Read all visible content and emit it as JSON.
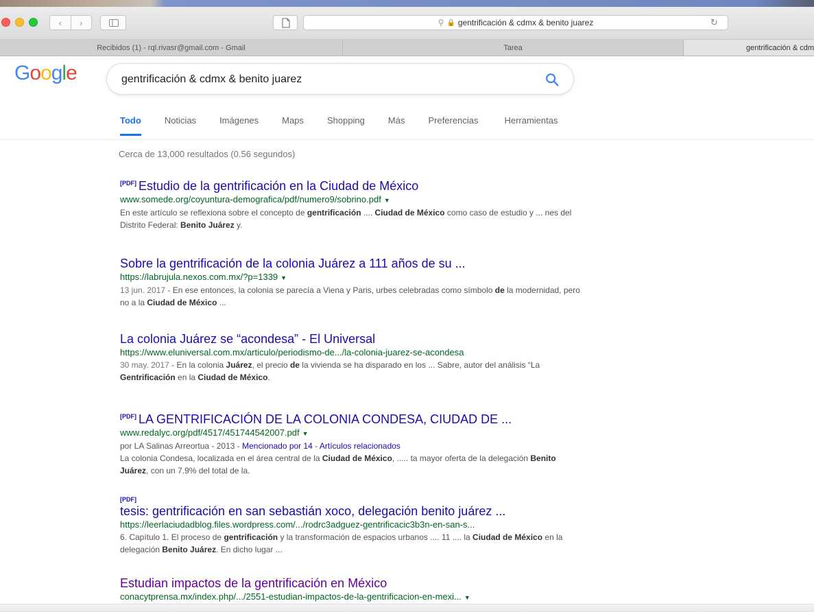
{
  "browser": {
    "address_text": "gentrificación & cdmx & benito juarez",
    "tabs": [
      {
        "label": "Recibidos (1) - rql.rivasr@gmail.com - Gmail"
      },
      {
        "label": "Tarea"
      },
      {
        "label": "gentrificación & cdm"
      }
    ],
    "back_glyph": "‹",
    "forward_glyph": "›"
  },
  "google": {
    "logo_letters": [
      "G",
      "o",
      "o",
      "g",
      "l",
      "e"
    ],
    "query": "gentrificación & cdmx & benito juarez",
    "tabs": [
      {
        "label": "Todo",
        "active": true
      },
      {
        "label": "Noticias"
      },
      {
        "label": "Imágenes"
      },
      {
        "label": "Maps"
      },
      {
        "label": "Shopping"
      },
      {
        "label": "Más"
      },
      {
        "label": "Preferencias"
      },
      {
        "label": "Herramientas"
      }
    ],
    "stats": "Cerca de 13,000 resultados (0.56 segundos)"
  },
  "results": [
    {
      "pdf_tag": "[PDF]",
      "title": "Estudio de la gentrificación en la Ciudad de México",
      "url": "www.somede.org/coyuntura-demografica/pdf/numero9/sobrino.pdf",
      "snippet": [
        {
          "t": "En este artículo se reflexiona sobre el concepto de "
        },
        {
          "t": "gentrificación",
          "b": true
        },
        {
          "t": " .... "
        },
        {
          "t": "Ciudad de México",
          "b": true
        },
        {
          "t": " como caso de estudio y ... nes del Distrito Federal: "
        },
        {
          "t": "Benito Juárez",
          "b": true
        },
        {
          "t": " y."
        }
      ]
    },
    {
      "title": "Sobre la gentrificación de la colonia Juárez a 111 años de su ...",
      "url": "https://labrujula.nexos.com.mx/?p=1339",
      "date": "13 jun. 2017",
      "snippet": [
        {
          "t": " - En ese entonces, la colonia se parecía a Viena y Paris, urbes celebradas como símbolo "
        },
        {
          "t": "de",
          "b": true
        },
        {
          "t": " la modernidad, pero no a la "
        },
        {
          "t": "Ciudad de México",
          "b": true
        },
        {
          "t": " ..."
        }
      ]
    },
    {
      "title": "La colonia Juárez se “acondesa” - El Universal",
      "url": "https://www.eluniversal.com.mx/articulo/periodismo-de.../la-colonia-juarez-se-acondesa",
      "date": "30 may. 2017",
      "snippet": [
        {
          "t": " - En la colonia "
        },
        {
          "t": "Juárez",
          "b": true
        },
        {
          "t": ", el precio "
        },
        {
          "t": "de",
          "b": true
        },
        {
          "t": " la vivienda se ha disparado en los ... Sabre, autor del análisis “La "
        },
        {
          "t": "Gentrificación",
          "b": true
        },
        {
          "t": " en la "
        },
        {
          "t": "Ciudad de México",
          "b": true
        },
        {
          "t": "."
        }
      ]
    },
    {
      "pdf_tag": "[PDF]",
      "title": "LA GENTRIFICACIÓN DE LA COLONIA CONDESA, CIUDAD DE ...",
      "url": "www.redalyc.org/pdf/4517/451744542007.pdf",
      "meta_prefix": "por LA Salinas Arreortua - 2013 - ",
      "meta_link1": "Mencionado por 14",
      "meta_sep": " - ",
      "meta_link2": "Artículos relacionados",
      "snippet": [
        {
          "t": "La colonia Condesa, localizada en el área central de la "
        },
        {
          "t": "Ciudad de México",
          "b": true
        },
        {
          "t": ", ..... ta mayor oferta de la delegación "
        },
        {
          "t": "Benito Juárez",
          "b": true
        },
        {
          "t": ", con un 7.9% del total de la."
        }
      ]
    },
    {
      "pdf_tag": "[PDF]",
      "title": "tesis: gentrificación en san sebastián xoco, delegación benito juárez ...",
      "url": "https://leerlaciudadblog.files.wordpress.com/.../rodrc3adguez-gentrificacic3b3n-en-san-s...",
      "snippet": [
        {
          "t": "6. Capítulo 1. El proceso de "
        },
        {
          "t": "gentrificación",
          "b": true
        },
        {
          "t": " y la transformación de espacios urbanos .... 11 .... la "
        },
        {
          "t": "Ciudad de México",
          "b": true
        },
        {
          "t": " en la delegación "
        },
        {
          "t": "Benito Juárez",
          "b": true
        },
        {
          "t": ". En dicho lugar ..."
        }
      ]
    },
    {
      "title": "Estudian impactos de la gentrificación en México",
      "url": "conacytprensa.mx/index.php/.../2551-estudian-impactos-de-la-gentrificacion-en-mexi..."
    }
  ],
  "colors": {
    "link": "#1a0dab",
    "visited": "#660099",
    "url": "#006621",
    "snippet": "#545454",
    "active_tab": "#1a73e8"
  }
}
